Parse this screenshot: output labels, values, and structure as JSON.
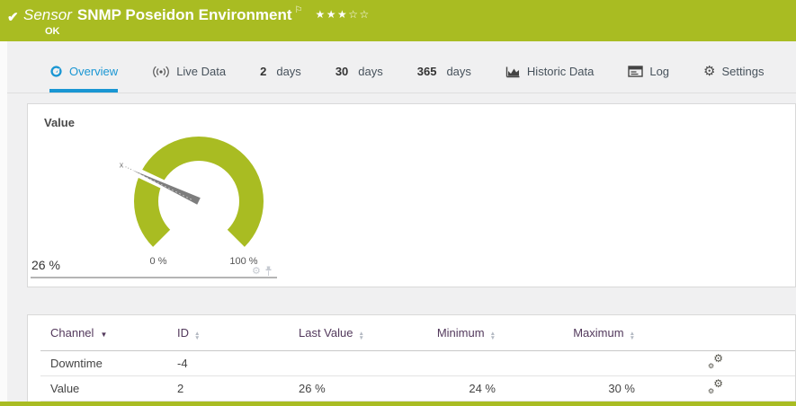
{
  "colors": {
    "brand_green": "#a9bc22",
    "accent_blue": "#1996d3",
    "needle_gray": "#7d7d7d"
  },
  "header": {
    "check_icon": "✔",
    "kind": "Sensor",
    "title": "SNMP Poseidon Environment",
    "flag_icon": "⚐",
    "stars_filled": "★★★",
    "stars_empty": "☆☆",
    "status": "OK"
  },
  "tabs": {
    "overview": {
      "label": "Overview"
    },
    "live": {
      "label": "Live Data"
    },
    "d2": {
      "num": "2",
      "unit": "days"
    },
    "d30": {
      "num": "30",
      "unit": "days"
    },
    "d365": {
      "num": "365",
      "unit": "days"
    },
    "historic": {
      "label": "Historic Data"
    },
    "log": {
      "label": "Log"
    },
    "settings": {
      "label": "Settings"
    }
  },
  "gauge": {
    "title": "Value",
    "value_percent": 26,
    "value_label": "26 %",
    "scale_min_label": "0 %",
    "scale_max_label": "100 %",
    "needle_marker": "x",
    "gear_icon": "⚙"
  },
  "chart_data": {
    "type": "gauge",
    "title": "Value",
    "value": 26,
    "min": 0,
    "max": 100,
    "unit": "%"
  },
  "channels_table": {
    "headers": {
      "channel": "Channel",
      "id": "ID",
      "last_value": "Last Value",
      "minimum": "Minimum",
      "maximum": "Maximum"
    },
    "rows": [
      {
        "channel": "Downtime",
        "id": "-4",
        "last_value": "",
        "minimum": "",
        "maximum": ""
      },
      {
        "channel": "Value",
        "id": "2",
        "last_value": "26 %",
        "minimum": "24 %",
        "maximum": "30 %"
      }
    ]
  }
}
